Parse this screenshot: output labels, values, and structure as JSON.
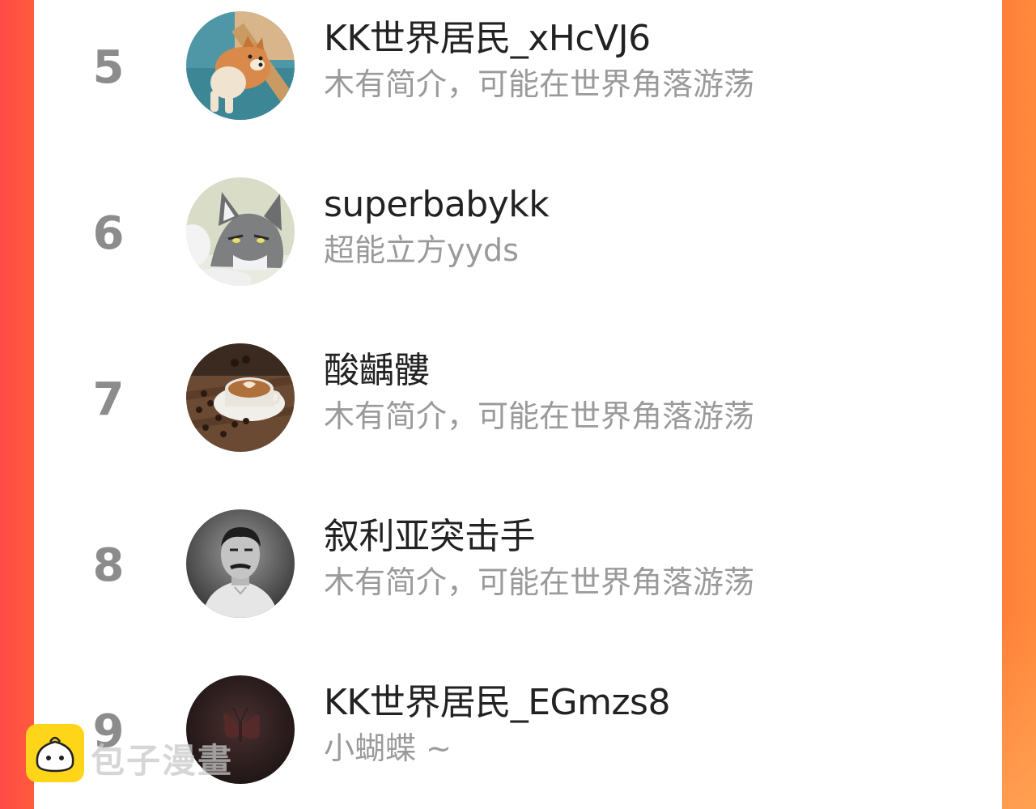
{
  "ranking": [
    {
      "rank": "5",
      "name": "KK世界居民_xHcVJ6",
      "bio": "木有简介，可能在世界角落游荡",
      "avatar": "shiba-dog-avatar"
    },
    {
      "rank": "6",
      "name": "superbabykk",
      "bio": "超能立方yyds",
      "avatar": "cartoon-wolf-avatar"
    },
    {
      "rank": "7",
      "name": "酸齲髏",
      "bio": "木有简介，可能在世界角落游荡",
      "avatar": "coffee-cup-avatar"
    },
    {
      "rank": "8",
      "name": "叙利亚突击手",
      "bio": "木有简介，可能在世界角落游荡",
      "avatar": "portrait-man-avatar"
    },
    {
      "rank": "9",
      "name": "KK世界居民_EGmzs8",
      "bio": "小蝴蝶 ~",
      "avatar": "dark-butterfly-avatar"
    }
  ],
  "watermark": {
    "text": "包子漫畫",
    "logo": "baozi-logo-icon"
  },
  "colors": {
    "border_left": "#ff4a48",
    "border_right": "#ff8a3c",
    "name_text": "#222222",
    "bio_text": "#9a9a9a",
    "rank_text": "#8c8c8c",
    "logo_yellow": "#ffd51a"
  }
}
